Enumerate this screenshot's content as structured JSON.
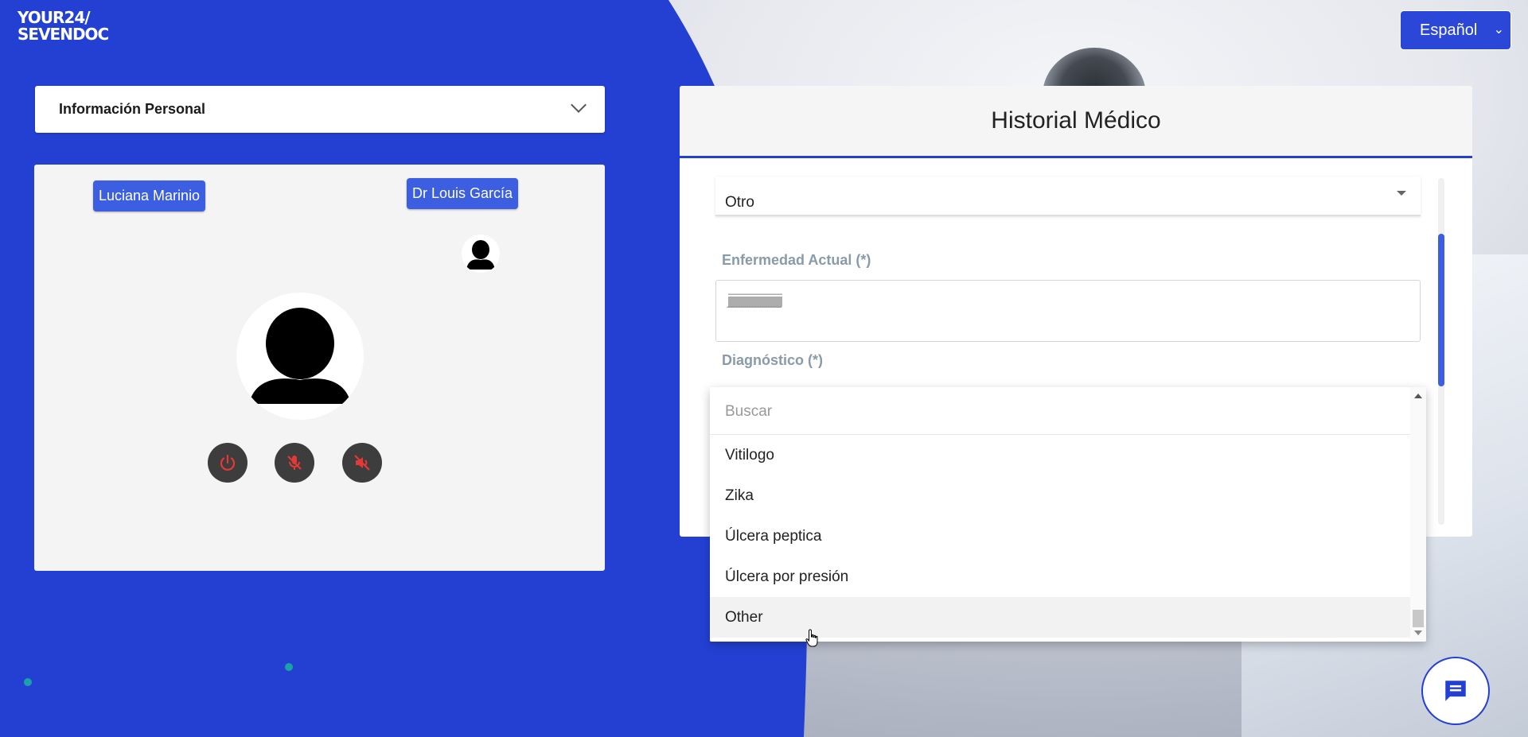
{
  "logo": {
    "line1": "YOUR24/",
    "line2": "SEVENDOC"
  },
  "language_select": {
    "value": "Español",
    "icon": "chevron-down-icon"
  },
  "personal_info": {
    "title": "Información Personal"
  },
  "video": {
    "patient_name": "Luciana Marinio",
    "doctor_name": "Dr Louis García",
    "controls": [
      "power-icon",
      "mic-off-icon",
      "volume-off-icon"
    ],
    "control_color": "#e53935"
  },
  "medical_history": {
    "title": "Historial Médico",
    "type_value": "Otro",
    "current_illness_label": "Enfermedad Actual (*)",
    "current_illness_value": "jjjjjjjjjjjjjjjjjjjjjjjjjjjjjjjjjj",
    "diagnosis_label": "Diagnóstico (*)"
  },
  "diagnosis_dropdown": {
    "search_placeholder": "Buscar",
    "options": [
      "Vitilogo",
      "Zika",
      "Úlcera peptica",
      "Úlcera por presión",
      "Other"
    ],
    "hovered": "Other"
  },
  "colors": {
    "brand_blue": "#2340d3",
    "accent_blue": "#3b5fe0",
    "teal_dot": "#1aa3a6"
  }
}
